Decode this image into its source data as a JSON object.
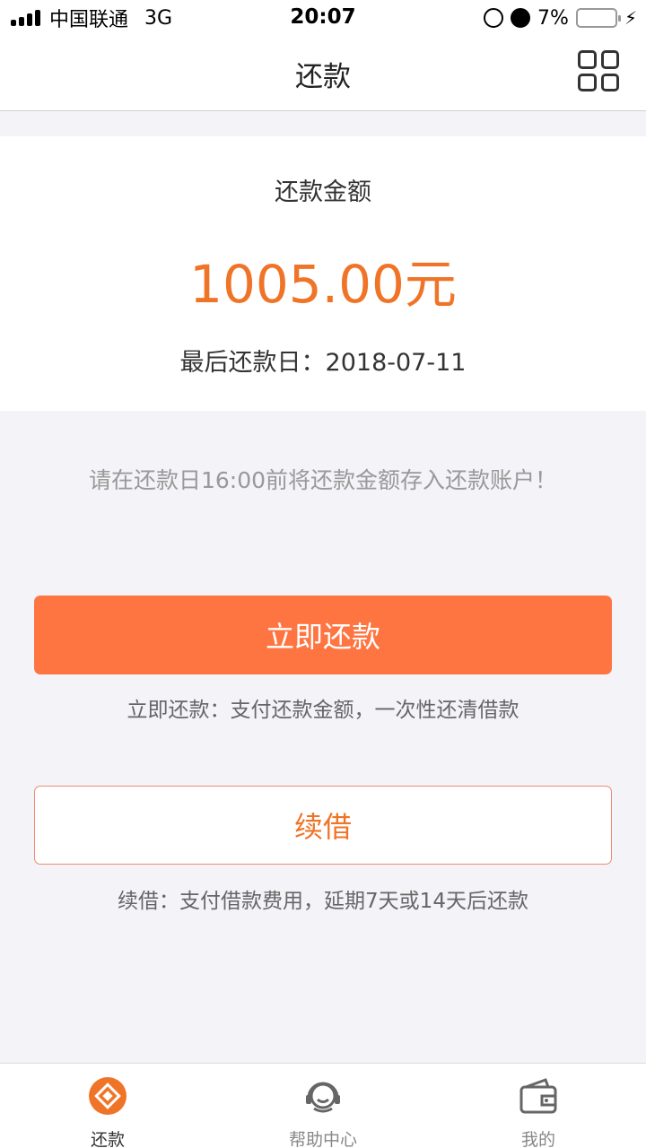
{
  "status_bar": {
    "carrier": "中国联通",
    "network": "3G",
    "time": "20:07",
    "battery": "7%",
    "battery_level": 0.07
  },
  "nav": {
    "title": "还款",
    "menu_icon": "grid-icon"
  },
  "repayment": {
    "amount_label": "还款金额",
    "amount": "1005.00元",
    "due_date": "最后还款日：2018-07-11",
    "notice": "请在还款日16:00前将还款金额存入还款账户！"
  },
  "actions": {
    "repay_now_label": "立即还款",
    "repay_now_desc": "立即还款：支付还款金额，一次性还清借款",
    "renew_label": "续借",
    "renew_desc": "续借：支付借款费用，延期7天或14天后还款"
  },
  "tabs": [
    {
      "label": "还款",
      "icon": "repay-icon",
      "active": true
    },
    {
      "label": "帮助中心",
      "icon": "headset-icon",
      "active": false
    },
    {
      "label": "我的",
      "icon": "wallet-icon",
      "active": false
    }
  ],
  "colors": {
    "accent": "#f07427",
    "primary_button": "#ff7542",
    "background": "#f3f3f8"
  }
}
